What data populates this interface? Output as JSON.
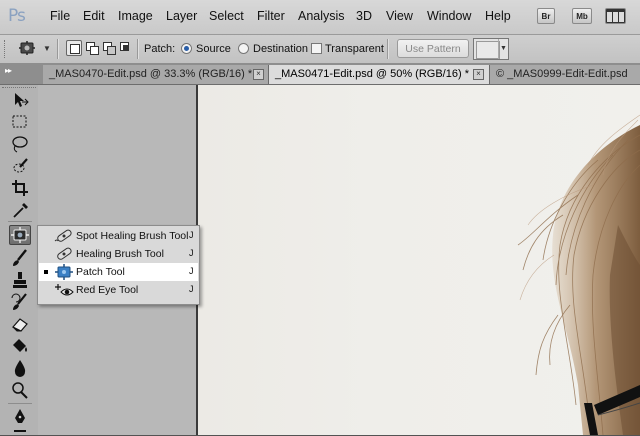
{
  "app": {
    "logo": "Ps"
  },
  "menu": [
    "File",
    "Edit",
    "Image",
    "Layer",
    "Select",
    "Filter",
    "Analysis",
    "3D",
    "View",
    "Window",
    "Help"
  ],
  "menu_buttons": [
    "Br",
    "Mb"
  ],
  "options": {
    "patch_label": "Patch:",
    "source_label": "Source",
    "destination_label": "Destination",
    "patch_mode": "Source",
    "transparent_label": "Transparent",
    "transparent_checked": false,
    "use_pattern_label": "Use Pattern"
  },
  "tabs": [
    {
      "label": "_MAS0470-Edit.psd @ 33.3% (RGB/16) *",
      "active": false
    },
    {
      "label": "_MAS0471-Edit.psd @ 50% (RGB/16) *",
      "active": true
    },
    {
      "label": "© _MAS0999-Edit-Edit.psd",
      "active": false
    }
  ],
  "toolbar": {
    "tools": [
      "move-tool",
      "marquee-tool",
      "lasso-tool",
      "quick-selection-tool",
      "crop-tool",
      "eyedropper-tool",
      "healing-tool",
      "brush-tool",
      "stamp-tool",
      "history-brush-tool",
      "eraser-tool",
      "paint-bucket-tool",
      "blur-tool",
      "dodge-tool",
      "pen-tool"
    ],
    "selected": "healing-tool"
  },
  "flyout": {
    "items": [
      {
        "label": "Spot Healing Brush Tool",
        "shortcut": "J",
        "icon": "spot-healing-brush-icon",
        "selected": false
      },
      {
        "label": "Healing Brush Tool",
        "shortcut": "J",
        "icon": "healing-brush-icon",
        "selected": false
      },
      {
        "label": "Patch Tool",
        "shortcut": "J",
        "icon": "patch-icon",
        "selected": true
      },
      {
        "label": "Red Eye Tool",
        "shortcut": "J",
        "icon": "red-eye-icon",
        "selected": false
      }
    ]
  },
  "colors": {
    "accent": "#2a5ea8",
    "hair": "#a88662"
  }
}
